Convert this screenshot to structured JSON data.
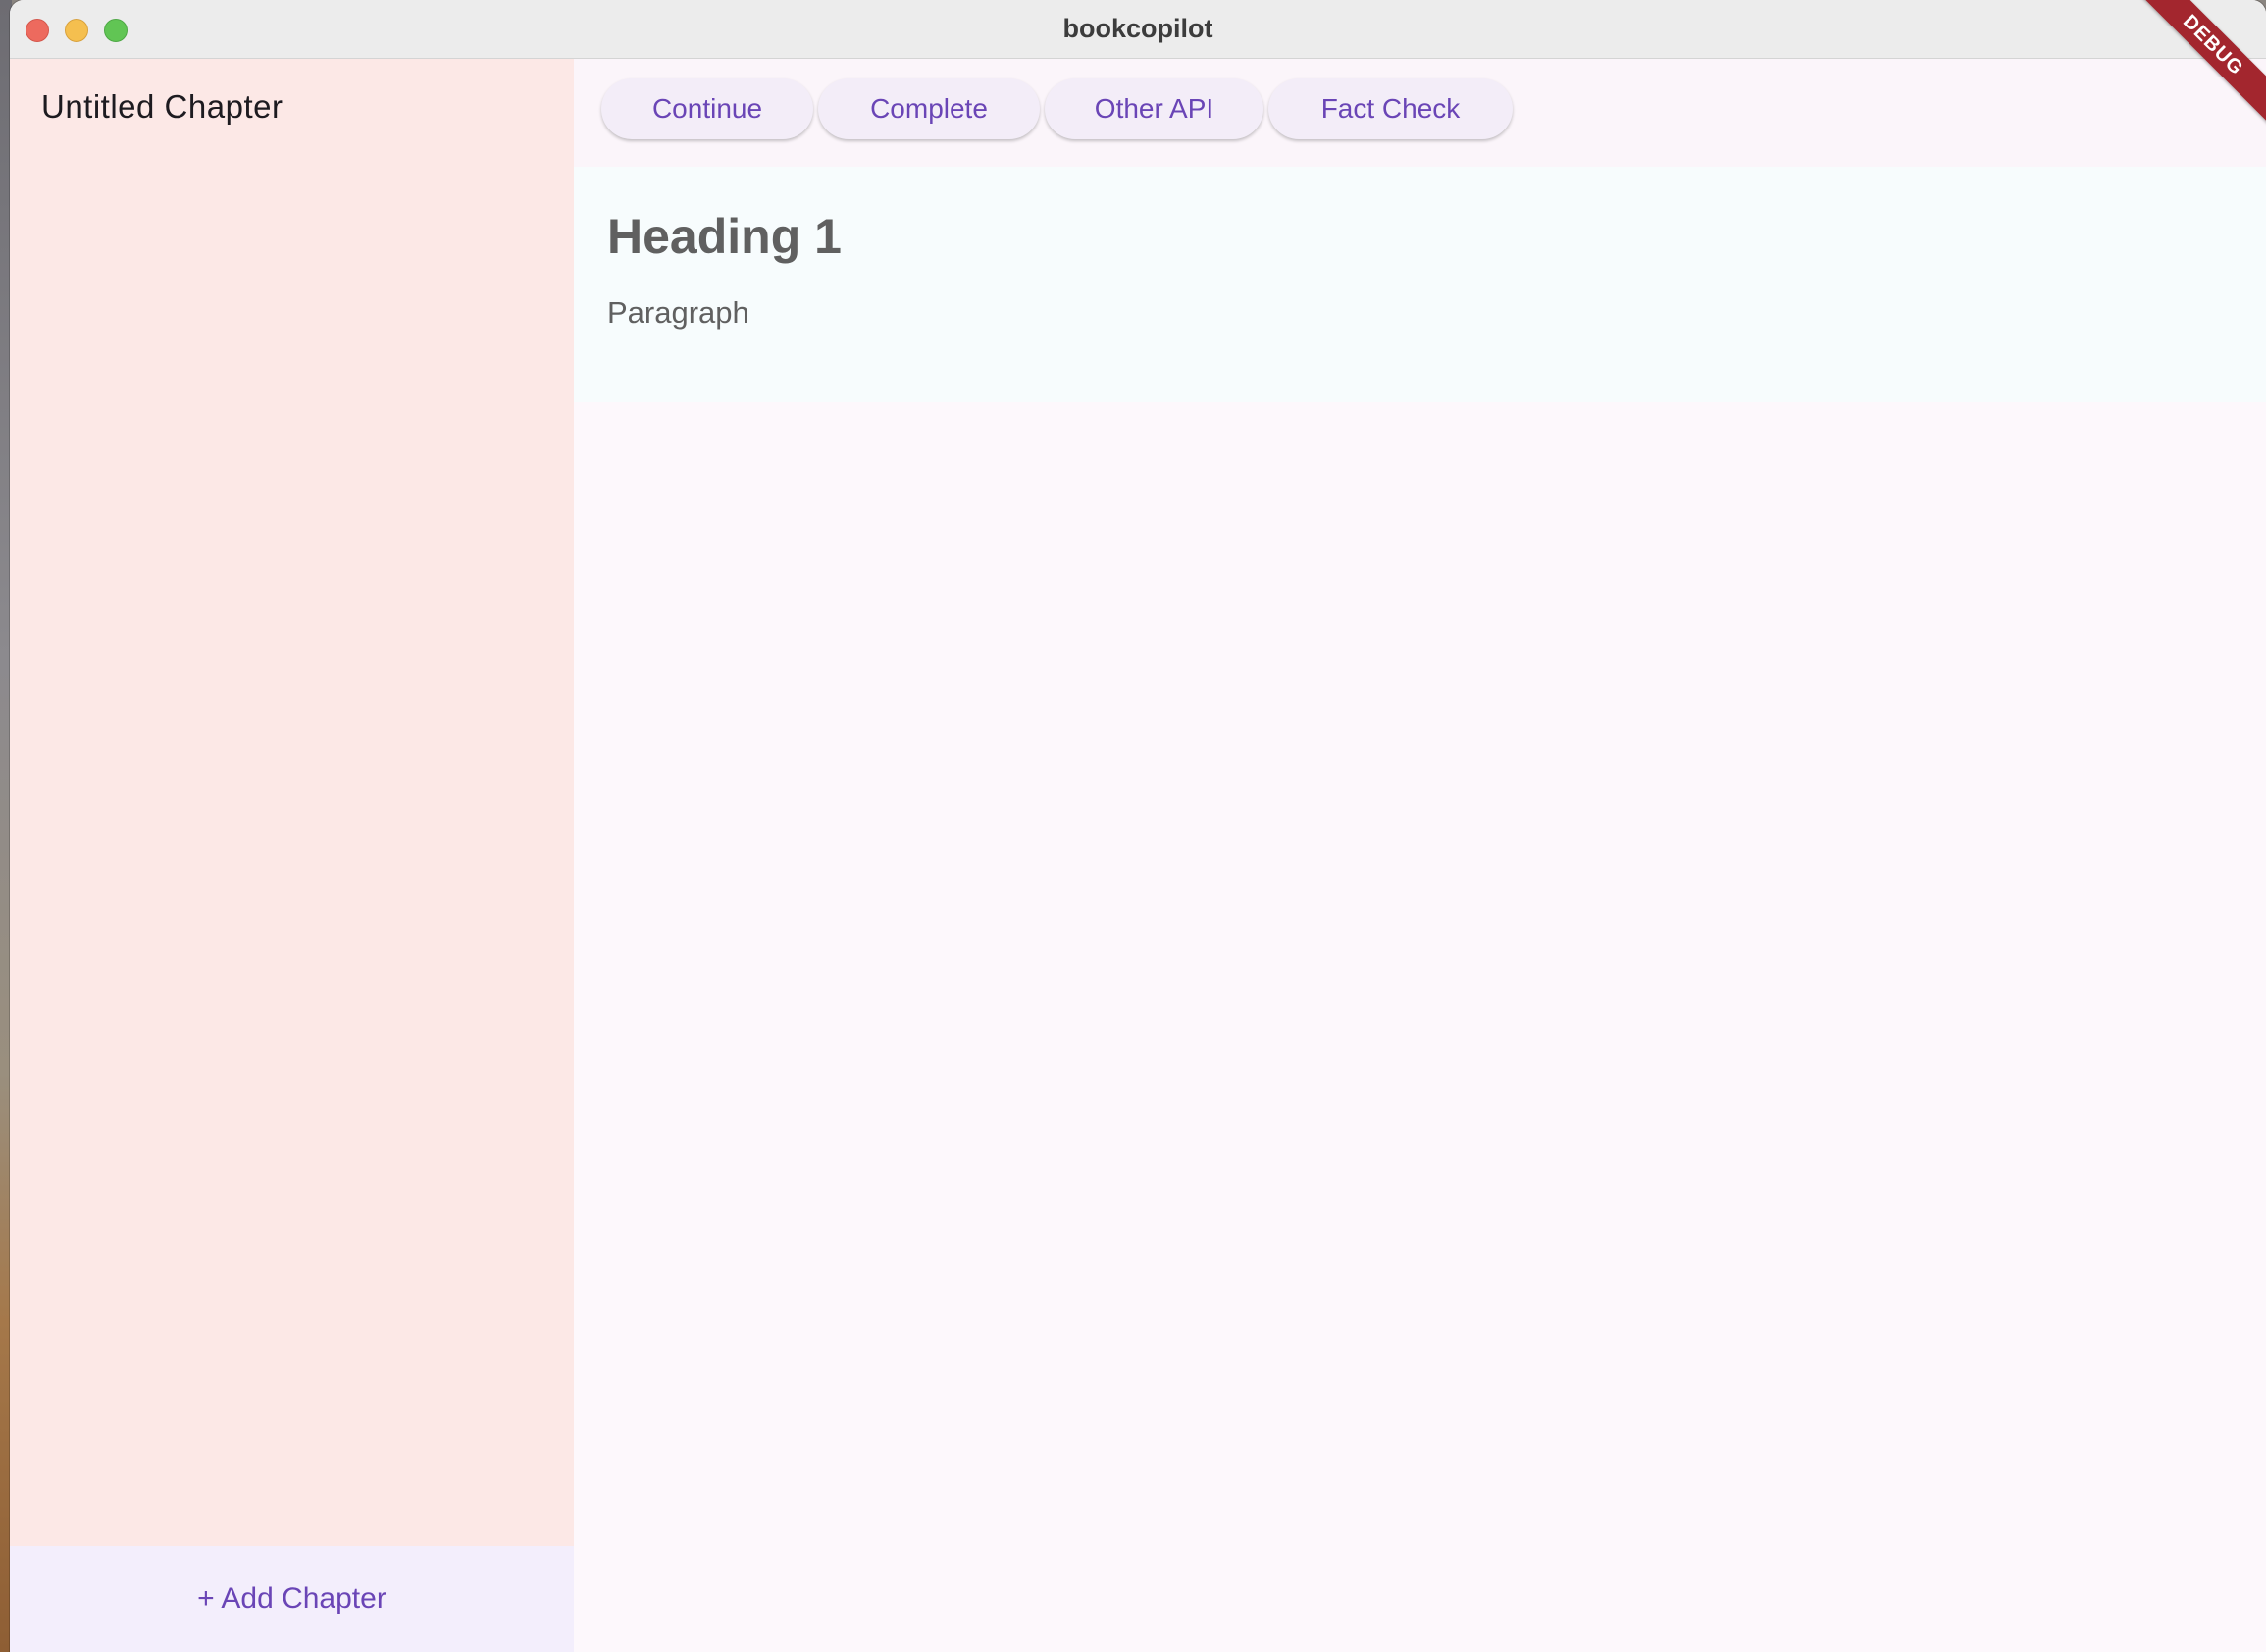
{
  "window": {
    "title": "bookcopilot"
  },
  "sidebar": {
    "chapters": [
      {
        "label": "Untitled Chapter"
      }
    ],
    "add_chapter_label": "+ Add Chapter"
  },
  "toolbar": {
    "buttons": [
      {
        "label": "Continue"
      },
      {
        "label": "Complete"
      },
      {
        "label": "Other API"
      },
      {
        "label": "Fact Check"
      }
    ]
  },
  "editor": {
    "heading": "Heading 1",
    "paragraph": "Paragraph"
  },
  "debug_banner": "DEBUG",
  "colors": {
    "accent": "#6a45b6",
    "sidebar_background": "#fce8e6",
    "debug_banner": "#a3262e"
  }
}
